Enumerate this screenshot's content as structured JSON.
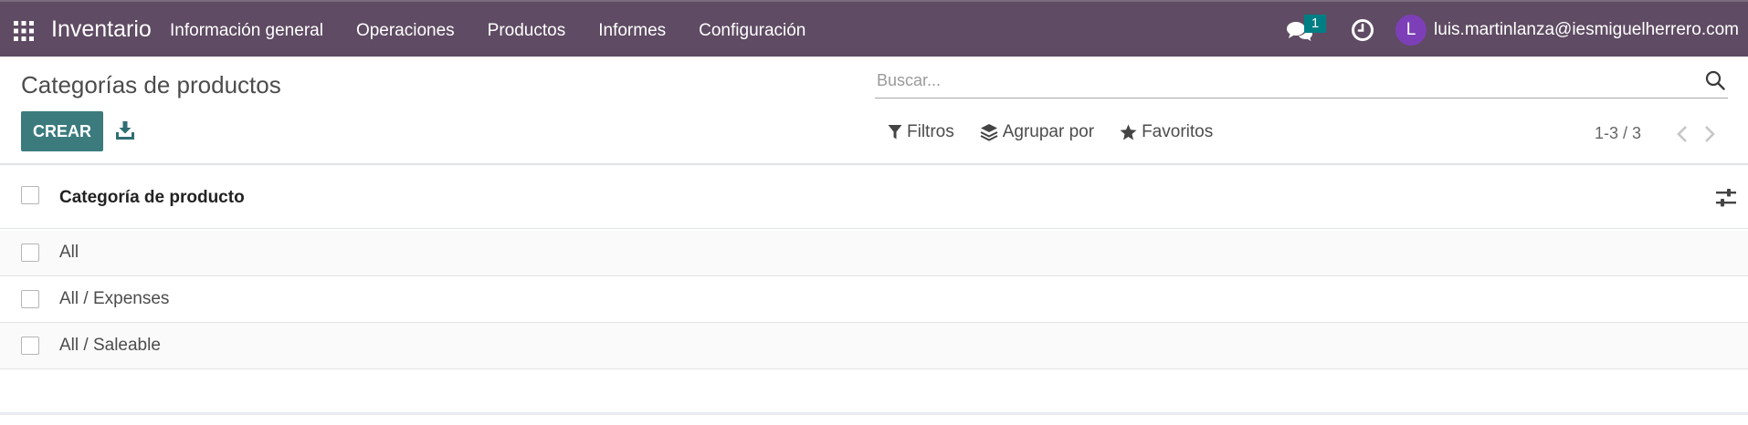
{
  "navbar": {
    "app_title": "Inventario",
    "menu": [
      {
        "label": "Información general"
      },
      {
        "label": "Operaciones"
      },
      {
        "label": "Productos"
      },
      {
        "label": "Informes"
      },
      {
        "label": "Configuración"
      }
    ],
    "chat_badge": "1",
    "user_initial": "L",
    "user_email": "luis.martinlanza@iesmiguelherrero.com",
    "colors": {
      "navbar_bg": "#5f4b63",
      "badge_bg": "#017e84",
      "avatar_bg": "#7c3fb7"
    }
  },
  "control_panel": {
    "title": "Categorías de productos",
    "create_label": "CREAR",
    "search_placeholder": "Buscar...",
    "filters_label": "Filtros",
    "group_by_label": "Agrupar por",
    "favorites_label": "Favoritos",
    "pager_value": "1-3 / 3",
    "colors": {
      "create_bg": "#3b7b7e"
    }
  },
  "list": {
    "column_header": "Categoría de producto",
    "rows": [
      {
        "name": "All"
      },
      {
        "name": "All / Expenses"
      },
      {
        "name": "All / Saleable"
      }
    ]
  },
  "icons": [
    "apps-icon",
    "chat-icon",
    "clock-icon",
    "download-icon",
    "search-icon",
    "filter-icon",
    "layers-icon",
    "star-icon",
    "chevron-left-icon",
    "chevron-right-icon",
    "sliders-icon"
  ]
}
